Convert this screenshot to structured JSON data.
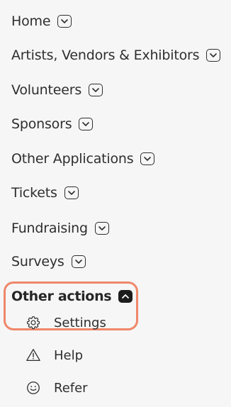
{
  "menu": {
    "items": [
      {
        "label": "Home",
        "icon": "chevron-down-icon"
      },
      {
        "label": "Artists, Vendors & Exhibitors",
        "icon": "chevron-down-icon"
      },
      {
        "label": "Volunteers",
        "icon": "chevron-down-icon"
      },
      {
        "label": "Sponsors",
        "icon": "chevron-down-icon"
      },
      {
        "label": "Other Applications",
        "icon": "chevron-down-icon"
      },
      {
        "label": "Tickets",
        "icon": "chevron-down-icon"
      },
      {
        "label": "Fundraising",
        "icon": "chevron-down-icon"
      },
      {
        "label": "Surveys",
        "icon": "chevron-down-icon"
      }
    ],
    "active_section": {
      "label": "Other actions",
      "icon": "chevron-up-icon",
      "expanded": true
    },
    "sub_items": [
      {
        "label": "Settings",
        "icon": "gear-icon"
      },
      {
        "label": "Help",
        "icon": "warning-icon"
      },
      {
        "label": "Refer",
        "icon": "smiley-icon"
      }
    ]
  },
  "colors": {
    "background": "#f6f6f6",
    "text": "#2e2e2e",
    "highlight_border": "#f0876a",
    "active_chevron_bg": "#1d1d1d"
  }
}
